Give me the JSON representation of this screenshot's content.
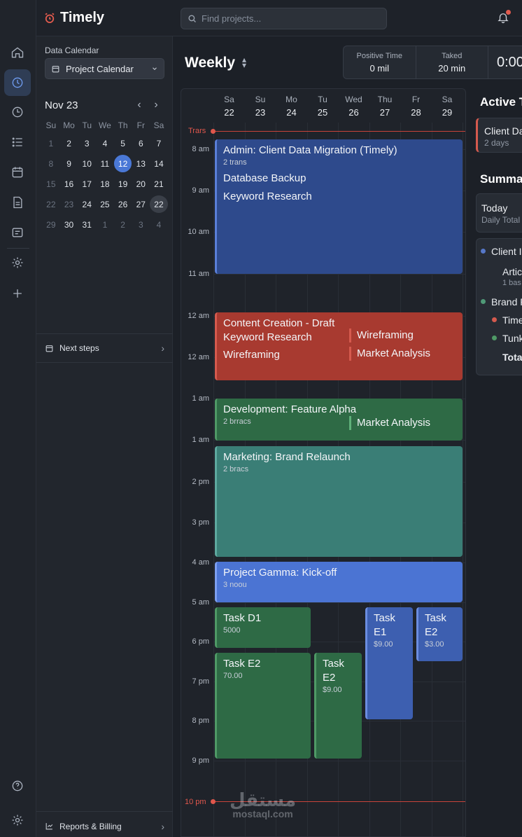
{
  "window": {
    "dot_colors": [
      "#ec5f57",
      "#f3bd4f",
      "#5fc454"
    ]
  },
  "app": {
    "name": "Timely",
    "accent": "#e25b4e"
  },
  "search": {
    "placeholder": "Find projects..."
  },
  "rail": {
    "items": [
      "home-icon",
      "clock-icon",
      "time-icon",
      "list-icon",
      "calendar-icon",
      "document-icon",
      "notes-icon",
      "gear-icon",
      "plus-icon",
      "help-icon",
      "settings-icon"
    ]
  },
  "panel": {
    "label": "Data Calendar",
    "calendar_select": "Project Calendar",
    "month": "Nov 23",
    "weekdays": [
      "Su",
      "Mo",
      "Tu",
      "We",
      "Th",
      "Fr",
      "Sa"
    ],
    "days": [
      [
        "1",
        "muted"
      ],
      [
        "2",
        ""
      ],
      [
        "3",
        ""
      ],
      [
        "4",
        ""
      ],
      [
        "5",
        ""
      ],
      [
        "6",
        ""
      ],
      [
        "7",
        ""
      ],
      [
        "8",
        "muted"
      ],
      [
        "9",
        ""
      ],
      [
        "10",
        ""
      ],
      [
        "11",
        ""
      ],
      [
        "12",
        "today"
      ],
      [
        "13",
        ""
      ],
      [
        "14",
        ""
      ],
      [
        "15",
        "muted"
      ],
      [
        "16",
        ""
      ],
      [
        "17",
        ""
      ],
      [
        "18",
        ""
      ],
      [
        "19",
        ""
      ],
      [
        "20",
        ""
      ],
      [
        "21",
        ""
      ],
      [
        "22",
        "muted"
      ],
      [
        "23",
        "muted"
      ],
      [
        "24",
        ""
      ],
      [
        "25",
        ""
      ],
      [
        "26",
        ""
      ],
      [
        "27",
        ""
      ],
      [
        "22",
        "sel"
      ],
      [
        "29",
        "muted"
      ],
      [
        "30",
        ""
      ],
      [
        "31",
        ""
      ],
      [
        "1",
        "muted"
      ],
      [
        "2",
        "muted"
      ],
      [
        "3",
        "muted"
      ],
      [
        "4",
        "muted"
      ]
    ],
    "next_steps": "Next steps",
    "reports": "Reports & Billing"
  },
  "main": {
    "title": "Weekly",
    "stats": [
      {
        "label": "Positive Time",
        "value": "0 mil"
      },
      {
        "label": "Taked",
        "value": "20 min"
      },
      {
        "label": "",
        "value": "0:00"
      }
    ]
  },
  "calendar": {
    "days": [
      {
        "name": "Sa",
        "num": "22"
      },
      {
        "name": "Su",
        "num": "23"
      },
      {
        "name": "Mo",
        "num": "24"
      },
      {
        "name": "Tu",
        "num": "25"
      },
      {
        "name": "Wed",
        "num": "26"
      },
      {
        "name": "Thu",
        "num": "27"
      },
      {
        "name": "Fr",
        "num": "28"
      },
      {
        "name": "Sa",
        "num": "29"
      }
    ],
    "now_label": "Trars",
    "end_label": "10 pm",
    "times": [
      "8 am",
      "9 am",
      "10 am",
      "11 am",
      "12 am",
      "12 am",
      "1 am",
      "1 am",
      "2 pm",
      "3 pm",
      "4 am",
      "5 am",
      "6 pm",
      "7 pm",
      "8 pm",
      "9 pm"
    ],
    "events": {
      "admin": {
        "title": "Admin: Client Data Migration (Timely)",
        "sub": "2 trans",
        "items": [
          "Database Backup",
          "Keyword Research"
        ]
      },
      "content": {
        "title": "Content Creation - Draft",
        "items": [
          "Keyword Research",
          "Wireframing"
        ],
        "right": [
          "Wireframing",
          "Market Analysis"
        ]
      },
      "dev": {
        "title": "Development: Feature Alpha",
        "sub": "2 brracs",
        "right": "Market Analysis"
      },
      "marketing": {
        "title": "Marketing: Brand Relaunch",
        "sub": "2 bracs"
      },
      "gamma": {
        "title": "Project Gamma: Kick-off",
        "sub": "3 noou"
      },
      "d1": {
        "title": "Task D1",
        "sub": "5000"
      },
      "e1": {
        "title": "Task E1",
        "sub": "$9.00"
      },
      "e2a": {
        "title": "Task E2",
        "sub": "$3.00"
      },
      "e2b": {
        "title": "Task E2",
        "sub": "70.00"
      },
      "e2c": {
        "title": "Task E2",
        "sub": "$9.00"
      }
    }
  },
  "right": {
    "active_title": "Active T",
    "active_card": {
      "title": "Client Da",
      "sub": "2 days"
    },
    "summary_title": "Summar",
    "today": {
      "title": "Today",
      "sub": "Daily Total"
    },
    "list": [
      {
        "label": "Client I",
        "dot": "#5677c8"
      },
      {
        "label": "Artic",
        "sub": "1 bas"
      },
      {
        "label": "Brand R",
        "dot": "#4f9a77"
      },
      {
        "label": "Time",
        "dot": "#d55a4e"
      },
      {
        "label": "Tunk",
        "dot": "#4f9a66"
      },
      {
        "label": "Tota"
      }
    ]
  },
  "watermark": {
    "arabic": "مستقل",
    "latin": "mostaql.com"
  }
}
